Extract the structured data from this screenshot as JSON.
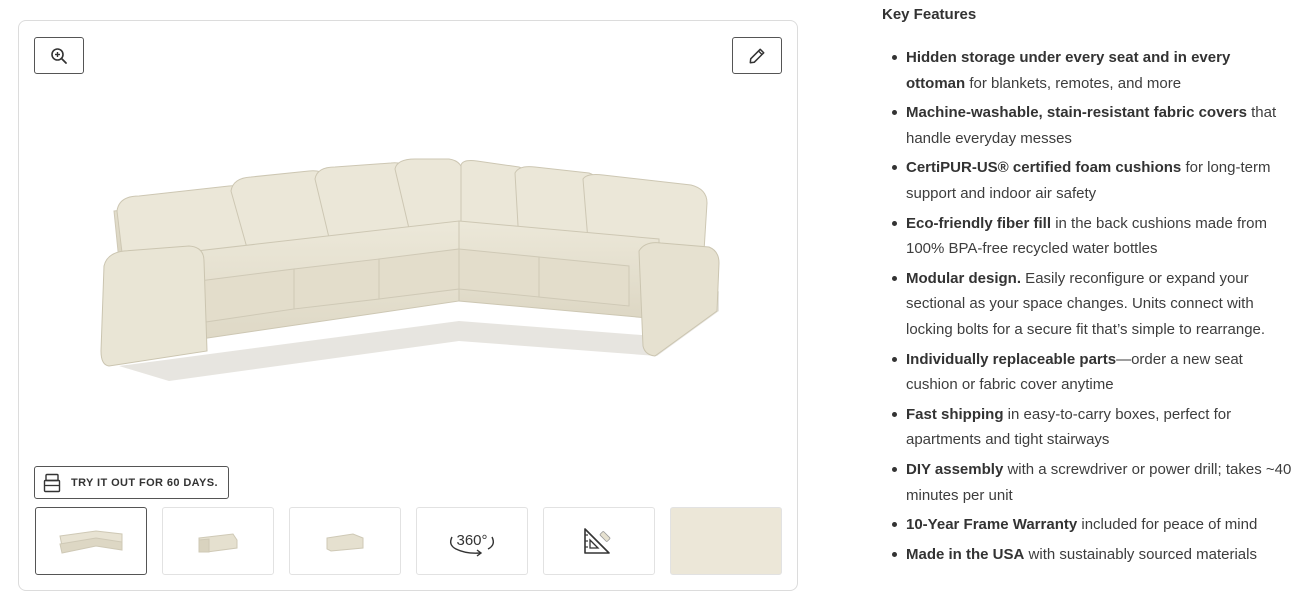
{
  "gallery": {
    "trial_label": "TRY IT OUT FOR 60 DAYS.",
    "thumb_360_label": "360°",
    "zoom_icon": "zoom-in-icon",
    "edit_icon": "pencil-icon",
    "colors": {
      "fabric": "#e8e3d3",
      "swatch": "#ece7d8",
      "border": "#dcdcdc"
    }
  },
  "features": {
    "heading": "Key Features",
    "items": [
      {
        "bold": "Hidden storage under every seat and in every ottoman",
        "text": " for blankets, remotes, and more"
      },
      {
        "bold": "Machine-washable, stain-resistant fabric covers",
        "text": " that handle everyday messes"
      },
      {
        "bold": "CertiPUR-US® certified foam cushions",
        "text": " for long-term support and indoor air safety"
      },
      {
        "bold": "Eco-friendly fiber fill",
        "text": " in the back cushions made from 100% BPA-free recycled water bottles"
      },
      {
        "bold": "Modular design.",
        "text": " Easily reconfigure or expand your sectional as your space changes. Units connect with locking bolts for a secure fit that’s simple to rearrange."
      },
      {
        "bold": "Individually replaceable parts",
        "text": "—order a new seat cushion or fabric cover anytime"
      },
      {
        "bold": "Fast shipping",
        "text": " in easy-to-carry boxes, perfect for apartments and tight stairways"
      },
      {
        "bold": "DIY assembly",
        "text": " with a screwdriver or power drill; takes ~40 minutes per unit"
      },
      {
        "bold": "10-Year Frame Warranty",
        "text": " included for peace of mind"
      },
      {
        "bold": "Made in the USA",
        "text": " with sustainably sourced materials"
      }
    ]
  }
}
